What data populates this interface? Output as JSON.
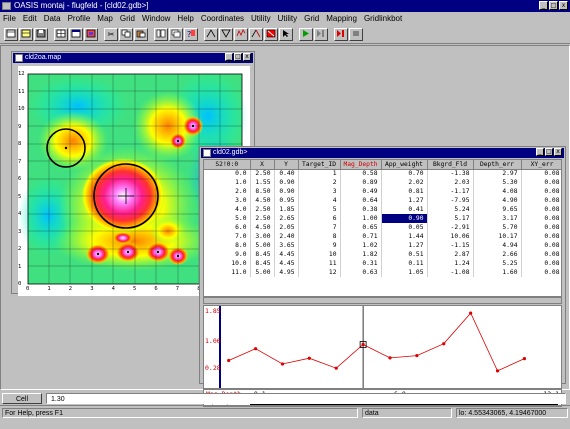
{
  "app": {
    "title": "OASIS montaj - flugfeld - [cld02.gdb>]",
    "controls": [
      "_",
      "□",
      "x"
    ]
  },
  "menu": [
    "File",
    "Edit",
    "Data",
    "Profile",
    "Map",
    "Grid",
    "Window",
    "Help",
    "Coordinates",
    "Utility",
    "Utility",
    "Grid",
    "Mapping",
    "Gridlinkbot"
  ],
  "map_window": {
    "title": "cld2oa.map",
    "controls": [
      "_",
      "□",
      "x"
    ],
    "x_ticks": [
      "0",
      "1",
      "2",
      "3",
      "4",
      "5",
      "6",
      "7",
      "8",
      "9",
      "10"
    ],
    "y_ticks": [
      "12",
      "11",
      "10",
      "9",
      "8",
      "7",
      "6",
      "5",
      "4",
      "3",
      "2",
      "1",
      "0"
    ]
  },
  "grid_window": {
    "title": "cld02.gdb>",
    "controls": [
      "_",
      "□",
      "x"
    ],
    "corner_label": "S2!0:0",
    "columns": [
      "X",
      "Y",
      "Target_ID",
      "Mag_Depth",
      "App_weight",
      "Bkgrd_Fld",
      "Depth_err",
      "XY_err"
    ],
    "rows": [
      [
        "0.0",
        "2.50",
        "0.40",
        "1",
        "0.58",
        "0.70",
        "-1.38",
        "2.97",
        "0.08"
      ],
      [
        "1.0",
        "1.55",
        "0.90",
        "2",
        "0.89",
        "2.02",
        "2.03",
        "5.30",
        "0.08"
      ],
      [
        "2.0",
        "8.50",
        "0.90",
        "3",
        "0.49",
        "0.81",
        "-1.17",
        "4.08",
        "0.08"
      ],
      [
        "3.0",
        "4.50",
        "0.95",
        "4",
        "0.64",
        "1.27",
        "-7.95",
        "4.90",
        "0.08"
      ],
      [
        "4.0",
        "2.50",
        "1.85",
        "5",
        "0.38",
        "0.41",
        "5.24",
        "9.65",
        "0.08"
      ],
      [
        "5.0",
        "2.50",
        "2.65",
        "6",
        "1.00",
        "0.90",
        "5.17",
        "3.17",
        "0.08"
      ],
      [
        "6.0",
        "4.50",
        "2.05",
        "7",
        "0.65",
        "0.05",
        "-2.91",
        "5.70",
        "0.08"
      ],
      [
        "7.0",
        "3.00",
        "2.40",
        "8",
        "0.71",
        "1.44",
        "10.06",
        "10.17",
        "0.08"
      ],
      [
        "8.0",
        "5.00",
        "3.65",
        "9",
        "1.02",
        "1.27",
        "-1.15",
        "4.94",
        "0.08"
      ],
      [
        "9.0",
        "8.45",
        "4.45",
        "10",
        "1.82",
        "0.51",
        "2.87",
        "2.66",
        "0.08"
      ],
      [
        "10.0",
        "8.45",
        "4.45",
        "11",
        "0.31",
        "0.11",
        "1.24",
        "5.25",
        "0.08"
      ],
      [
        "11.0",
        "5.00",
        "4.95",
        "12",
        "0.63",
        "1.05",
        "-1.08",
        "1.60",
        "0.08"
      ]
    ],
    "selected_cell": "1.00"
  },
  "profile": {
    "y_labels": [
      "1.85",
      "1.06",
      "0.28"
    ],
    "axis_label": "Mag_Depth",
    "x_start": "-0.1",
    "x_mid": "6.0",
    "x_end": "12.1",
    "fid_label": "(Fid)"
  },
  "chart_data": {
    "type": "line",
    "x": [
      0,
      1,
      2,
      3,
      4,
      5,
      6,
      7,
      8,
      9,
      10,
      11
    ],
    "values": [
      0.58,
      0.89,
      0.49,
      0.64,
      0.38,
      1.0,
      0.65,
      0.71,
      1.02,
      1.82,
      0.31,
      0.63
    ],
    "ylim": [
      0.28,
      1.85
    ],
    "xlim": [
      -0.1,
      12.1
    ],
    "color": "#dd0000"
  },
  "cell_bar": {
    "label": "Cell",
    "value": "1.30"
  },
  "status": {
    "help": "For Help, press F1",
    "mode": "data",
    "coords": "lo: 4.55343065, 4.19467000"
  },
  "colors": {
    "titlebar": "#000080",
    "face": "#c0c0c0",
    "accent_red": "#cc0000"
  }
}
